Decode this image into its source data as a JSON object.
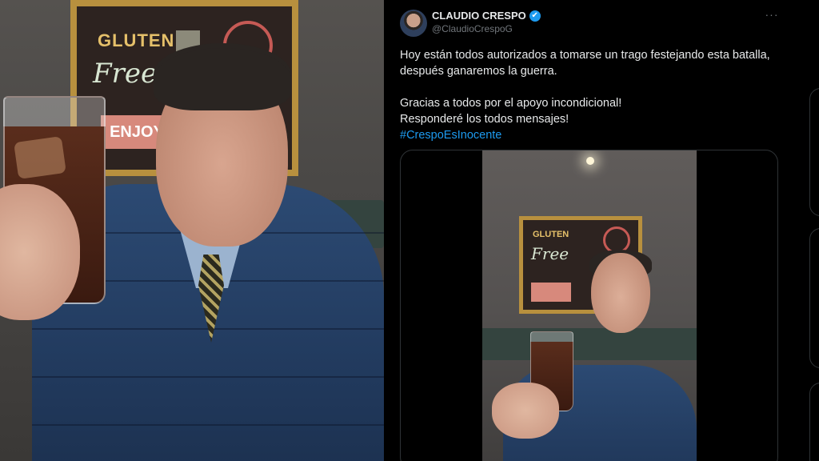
{
  "left_video": {
    "wall_art_words": [
      "GLUTEN",
      "Free",
      "ENJOY"
    ]
  },
  "tweet": {
    "author_name": "CLAUDIO CRESPO",
    "author_handle": "@ClaudioCrespoG",
    "verified_icon": "✔",
    "more_icon": "···",
    "text_lines": [
      "Hoy están todos autorizados a tomarse un trago festejando esta batalla,",
      "después ganaremos la guerra.",
      "",
      "Gracias a todos por el apoyo incondicional!",
      "Responderé los todos mensajes!"
    ],
    "hashtag": "#CrespoEsInocente"
  },
  "colors": {
    "background": "#000000",
    "text_primary": "#e7e9ea",
    "text_secondary": "#71767b",
    "accent_link": "#1d9bf0",
    "border": "#2f3336"
  }
}
